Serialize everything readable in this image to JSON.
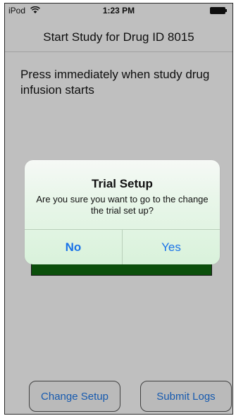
{
  "status_bar": {
    "carrier": "iPod",
    "time": "1:23 PM",
    "wifi_icon": "wifi-icon",
    "battery_icon": "battery-icon"
  },
  "nav": {
    "title": "Start Study for Drug ID  8015"
  },
  "main": {
    "instruction": "Press immediately when study drug infusion starts",
    "start_button_color": "#0d5a0d"
  },
  "alert": {
    "title": "Trial Setup",
    "message": "Are you sure you want to go to the change the trial set up?",
    "buttons": [
      "No",
      "Yes"
    ],
    "accent_color": "#1a73e8"
  },
  "footer": {
    "change_setup_label": "Change Setup",
    "submit_logs_label": "Submit Logs"
  }
}
